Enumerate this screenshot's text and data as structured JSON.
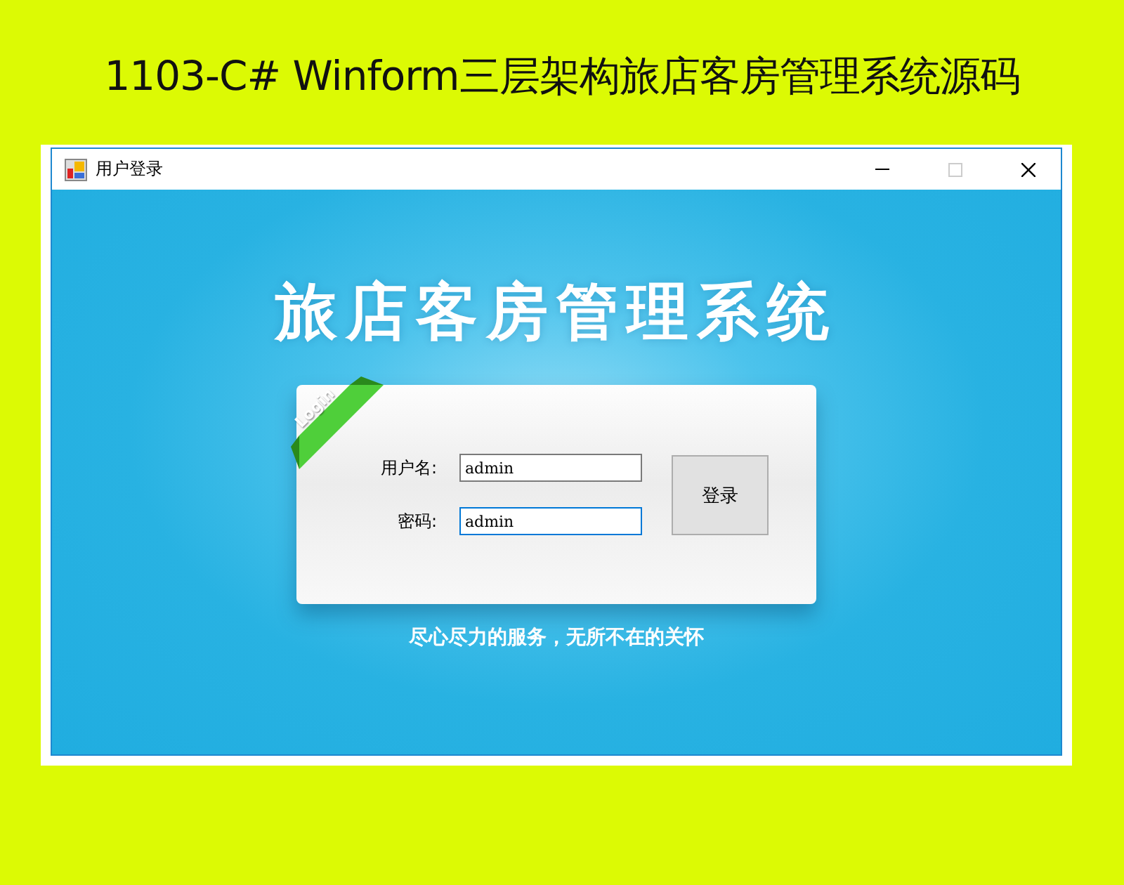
{
  "heading": "1103-C# Winform三层架构旅店客房管理系统源码",
  "window": {
    "title": "用户登录"
  },
  "app_title": "旅店客房管理系统",
  "ribbon": "Login",
  "fields": [
    {
      "label": "用户名:",
      "value": "admin",
      "focused": false
    },
    {
      "label": "密码:",
      "value": "admin",
      "focused": true
    }
  ],
  "button": "登录",
  "slogan": "尽心尽力的服务，无所不在的关怀"
}
